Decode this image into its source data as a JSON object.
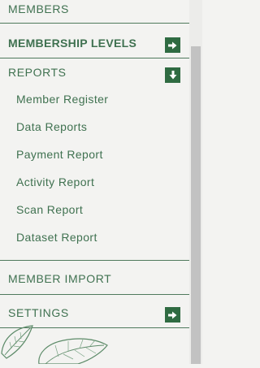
{
  "menu": {
    "members": "MEMBERS",
    "membership_levels": "MEMBERSHIP LEVELS",
    "reports": "REPORTS",
    "reports_children": [
      "Member Register",
      "Data Reports",
      "Payment Report",
      "Activity Report",
      "Scan Report",
      "Dataset Report"
    ],
    "member_import": "MEMBER IMPORT",
    "settings": "SETTINGS"
  },
  "icons": {
    "expand": "arrow-right-icon",
    "collapse": "arrow-down-icon",
    "decoration": "monstera-leaf-icon"
  },
  "colors": {
    "text": "#3f7150",
    "button": "#2f6b42",
    "background": "#f3f3f1"
  }
}
